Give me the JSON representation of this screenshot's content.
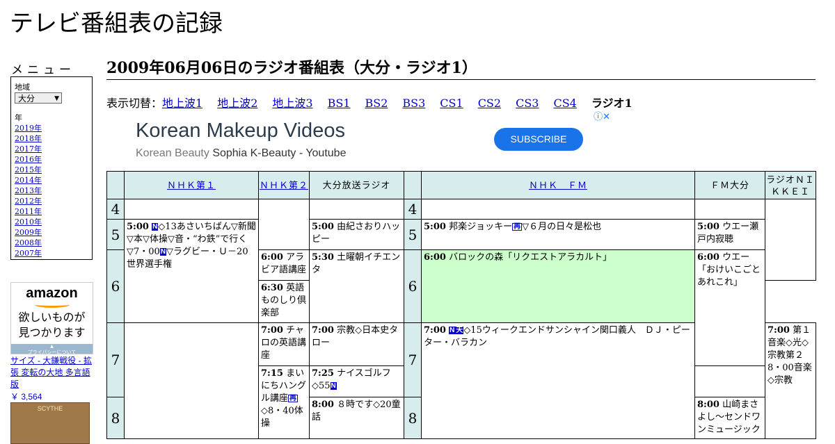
{
  "site_title": "テレビ番組表の記録",
  "sidebar": {
    "menu_title": "メニュー",
    "region_label": "地域",
    "region_value": "大分",
    "year_label": "年",
    "years": [
      "2019年",
      "2018年",
      "2017年",
      "2016年",
      "2015年",
      "2014年",
      "2013年",
      "2012年",
      "2011年",
      "2010年",
      "2009年",
      "2008年",
      "2007年"
    ]
  },
  "amazon_ad": {
    "logo": "amazon",
    "tagline_1": "欲しいものが",
    "tagline_2": "見つかります",
    "privacy": "プライバシーについて",
    "product_title": "サイズ - 大鎌戦役 - 拡張 変転の大地 多言語版",
    "product_price": "￥ 3,564",
    "product_image_text": "SCYTHE"
  },
  "heading": "2009年06月06日のラジオ番組表（大分・ラジオ1）",
  "switcher": {
    "label": "表示切替：",
    "links": [
      "地上波1",
      "地上波2",
      "地上波3",
      "BS1",
      "BS2",
      "BS3",
      "CS1",
      "CS2",
      "CS3",
      "CS4"
    ],
    "current": "ラジオ1"
  },
  "google_ad": {
    "headline": "Korean Makeup Videos",
    "sub_a": "Korean Beauty",
    "sub_b": "Sophia K-Beauty - Youtube",
    "button": "SUBSCRIBE",
    "info_icon": "ⓘ✕"
  },
  "channels": [
    {
      "name": "ＮＨＫ第１",
      "link": true
    },
    {
      "name": "ＮＨＫ第２",
      "link": true
    },
    {
      "name": "大分放送ラジオ",
      "link": false
    },
    {
      "name": "ＮＨＫ　ＦＭ",
      "link": true
    },
    {
      "name": "ＦＭ大分",
      "link": false
    },
    {
      "name": "ラジオＮＩＫＫＥＩ",
      "link": false
    }
  ],
  "hours": [
    "4",
    "5",
    "6",
    "7",
    "8"
  ],
  "programs": {
    "nhk1_0500_time": "5:00",
    "nhk1_0500_a": "◇13あさいちばん▽新聞▽本▽体操▽音・“わ鉄”で行く▽7・00",
    "nhk1_0500_b": "▽ラグビー・Ｕ－20世界選手権",
    "nhk2_0600_time": "6:00",
    "nhk2_0600": "アラビア語講座",
    "nhk2_0630_time": "6:30",
    "nhk2_0630": "英語ものしり倶楽部",
    "nhk2_0700_time": "7:00",
    "nhk2_0700": "チャロの英語講座",
    "nhk2_0715_time": "7:15",
    "nhk2_0715_a": "まいにちハングル講座",
    "nhk2_0715_b": "◇8・40体操",
    "obs_0500_time": "5:00",
    "obs_0500": "由紀さおりハッピー",
    "obs_0530_time": "5:30",
    "obs_0530": "土曜朝イチエンタ",
    "obs_0700_time": "7:00",
    "obs_0700": "宗教◇日本史タロー",
    "obs_0725_time": "7:25",
    "obs_0725": "ナイスゴルフ◇55",
    "obs_0800_time": "8:00",
    "obs_0800": "８時です◇20童話",
    "fm_0500_time": "5:00",
    "fm_0500_a": "邦楽ジョッキー",
    "fm_0500_b": "▽６月の日々是松也",
    "fm_0600_time": "6:00",
    "fm_0600": "バロックの森「リクエストアラカルト」",
    "fm_0700_time": "7:00",
    "fm_0700": "◇15ウィークエンドサンシャイン関口義人　ＤＪ・ピーター・バラカン",
    "fmo_0500_time": "5:00",
    "fmo_0500": "ウエー瀬戸内寂聴",
    "fmo_0600_time": "6:00",
    "fmo_0600": "ウエー「おけいこごとあれこれ」",
    "fmo_0800_time": "8:00",
    "fmo_0800": "山崎まさよし～センドワンミュージック",
    "nikkei_0700_time": "7:00",
    "nikkei_0700": "第１音楽◇光◇宗教第２　8・00音楽◇宗教"
  },
  "marks": {
    "n": "N",
    "stereo": "再",
    "ten": "天"
  }
}
